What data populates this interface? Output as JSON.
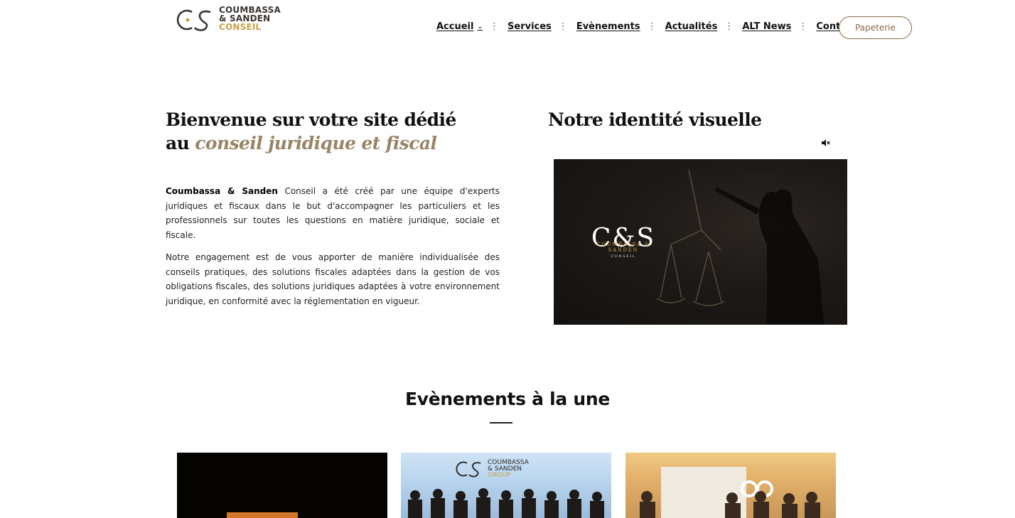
{
  "logo": {
    "line1": "COUMBASSA",
    "line2": "& SANDEN",
    "line3": "CONSEIL",
    "icon": "cs-monogram-icon"
  },
  "nav": {
    "items": [
      {
        "label": "Accueil",
        "has_dropdown": true
      },
      {
        "label": "Services"
      },
      {
        "label": "Evènements"
      },
      {
        "label": "Actualités"
      },
      {
        "label": "ALT News"
      },
      {
        "label": "Contact"
      }
    ],
    "cta_label": "Papeterie"
  },
  "welcome": {
    "line1": "Bienvenue sur votre site dédié",
    "line2_prefix": "au",
    "line2_accent": "conseil juridique et fiscal"
  },
  "intro": {
    "p1_strong": "Coumbassa & Sanden",
    "p1_rest": " Conseil a été créé par une équipe d'experts juridiques et fiscaux dans le but d'accompagner les particuliers et les professionnels sur toutes les questions en matière juridique, sociale et fiscale.",
    "p2": "Notre engagement est de vous apporter de manière individualisée des conseils pratiques, des solutions fiscales adaptées dans la gestion de vos obligations fiscales, des solutions juridiques adaptées à votre environnement juridique, en conformité avec la réglementation en vigueur."
  },
  "identity": {
    "title": "Notre identité visuelle",
    "mute_icon": "speaker-muted-icon",
    "video_logo_cs": "C&S",
    "video_logo_name": "COUMBASSA & SANDEN",
    "video_logo_sub": "CONSEIL"
  },
  "events": {
    "title": "Evènements à la une",
    "card2_logo_line1": "COUMBASSA",
    "card2_logo_line2": "& SANDEN",
    "card2_logo_line3": "GROUP"
  },
  "colors": {
    "accent_gold": "#c9a24a",
    "accent_taupe": "#9a8466",
    "button_border": "#8a6a4a"
  }
}
